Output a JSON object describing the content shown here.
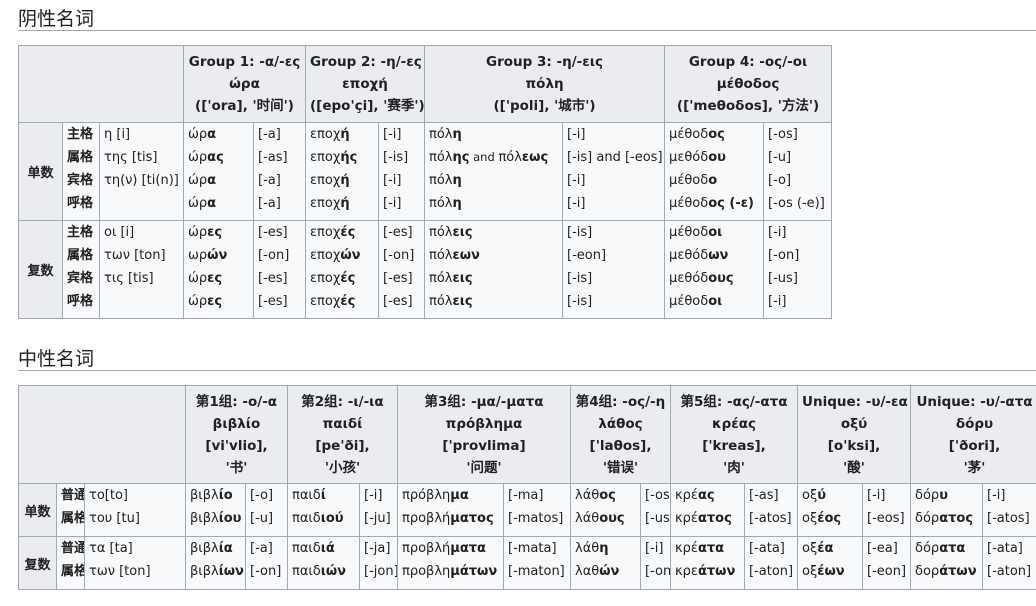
{
  "fem": {
    "title": "阴性名词",
    "groups": [
      {
        "l1": "Group 1: -α/-ες",
        "l2": "ώρα",
        "l3": "(['ora], '时间')"
      },
      {
        "l1": "Group 2: -η/-ες",
        "l2": "εποχή",
        "l3": "([epo'çi], '赛季')"
      },
      {
        "l1": "Group 3: -η/-εις",
        "l2": "πόλη",
        "l3": "(['poli], '城市')"
      },
      {
        "l1": "Group 4: -ος/-οι",
        "l2": "μέθοδος",
        "l3": "(['meθoδos], '方法')"
      }
    ],
    "blocks": [
      {
        "number": "单数",
        "cases": [
          "主格",
          "属格",
          "宾格",
          "呼格"
        ],
        "articles": [
          "η [i]",
          "της [tis]",
          "τη(ν) [ti(n)]",
          ""
        ],
        "cols": [
          {
            "forms": [
              [
                "ώρ",
                "α"
              ],
              [
                "ώρ",
                "ας"
              ],
              [
                "ώρ",
                "α"
              ],
              [
                "ώρ",
                "α"
              ]
            ],
            "ipa": [
              "[-a]",
              "[-as]",
              "[-a]",
              "[-a]"
            ]
          },
          {
            "forms": [
              [
                "εποχ",
                "ή"
              ],
              [
                "εποχ",
                "ής"
              ],
              [
                "εποχ",
                "ή"
              ],
              [
                "εποχ",
                "ή"
              ]
            ],
            "ipa": [
              "[-i]",
              "[-is]",
              "[-i]",
              "[-i]"
            ]
          },
          {
            "forms": [
              [
                "πόλ",
                "η"
              ],
              [
                "πόλ",
                "ης"
              ],
              [
                "πόλ",
                "η"
              ],
              [
                "πόλ",
                "η"
              ]
            ],
            "extra": {
              "and": " and ",
              "stem": "πόλ",
              "end": "εως"
            },
            "ipa": [
              "[-i]",
              "[-is] and [-eos]",
              "[-i]",
              "[-i]"
            ]
          },
          {
            "forms": [
              [
                "μέθοδ",
                "ος"
              ],
              [
                "μεθόδ",
                "ου"
              ],
              [
                "μέθοδ",
                "ο"
              ],
              [
                "μέθοδ",
                "ος (-ε)"
              ]
            ],
            "ipa": [
              "[-os]",
              "[-u]",
              "[-o]",
              "[-os (-e)]"
            ]
          }
        ]
      },
      {
        "number": "复数",
        "cases": [
          "主格",
          "属格",
          "宾格",
          "呼格"
        ],
        "articles": [
          "οι [i]",
          "των [ton]",
          "τις [tis]",
          ""
        ],
        "cols": [
          {
            "forms": [
              [
                "ώρ",
                "ες"
              ],
              [
                "ωρ",
                "ών"
              ],
              [
                "ώρ",
                "ες"
              ],
              [
                "ώρ",
                "ες"
              ]
            ],
            "ipa": [
              "[-es]",
              "[-on]",
              "[-es]",
              "[-es]"
            ]
          },
          {
            "forms": [
              [
                "εποχ",
                "ές"
              ],
              [
                "εποχ",
                "ών"
              ],
              [
                "εποχ",
                "ές"
              ],
              [
                "εποχ",
                "ές"
              ]
            ],
            "ipa": [
              "[-es]",
              "[-on]",
              "[-es]",
              "[-es]"
            ]
          },
          {
            "forms": [
              [
                "πόλ",
                "εις"
              ],
              [
                "πόλ",
                "εων"
              ],
              [
                "πόλ",
                "εις"
              ],
              [
                "πόλ",
                "εις"
              ]
            ],
            "ipa": [
              "[-is]",
              "[-eon]",
              "[-is]",
              "[-is]"
            ]
          },
          {
            "forms": [
              [
                "μέθοδ",
                "οι"
              ],
              [
                "μεθόδ",
                "ων"
              ],
              [
                "μεθόδ",
                "ους"
              ],
              [
                "μέθοδ",
                "οι"
              ]
            ],
            "ipa": [
              "[-i]",
              "[-on]",
              "[-us]",
              "[-i]"
            ]
          }
        ]
      }
    ]
  },
  "neu": {
    "title": "中性名词",
    "groups": [
      {
        "l1": "第1组: -ο/-α",
        "l2": "βιβλίο",
        "l3": "[vi'vlio],",
        "l4": "'书'"
      },
      {
        "l1": "第2组: -ι/-ια",
        "l2": "παιδί",
        "l3": "[pe'ði],",
        "l4": "'小孩'"
      },
      {
        "l1": "第3组: -μα/-ματα",
        "l2": "πρόβλημα",
        "l3": "['provlima]",
        "l4": "'问题'"
      },
      {
        "l1": "第4组: -ος/-η",
        "l2": "λάθος",
        "l3": "['laθos],",
        "l4": "'错误'"
      },
      {
        "l1": "第5组: -ας/-ατα",
        "l2": "κρέας",
        "l3": "['kreas],",
        "l4": "'肉'"
      },
      {
        "l1": "Unique: -υ/-εα",
        "l2": "οξύ",
        "l3": "[o'ksi],",
        "l4": "'酸'"
      },
      {
        "l1": "Unique: -υ/-ατα",
        "l2": "δόρυ",
        "l3": "['ðori],",
        "l4": "'茅'"
      }
    ],
    "blocks": [
      {
        "number": "单数",
        "cases": [
          "普通",
          "属格"
        ],
        "articles": [
          "το[to]",
          "του [tu]"
        ],
        "cols": [
          {
            "forms": [
              [
                "βιβλ",
                "ίο"
              ],
              [
                "βιβλ",
                "ίου"
              ]
            ],
            "ipa": [
              "[-o]",
              "[-u]"
            ]
          },
          {
            "forms": [
              [
                "παιδ",
                "ί"
              ],
              [
                "παιδ",
                "ιού"
              ]
            ],
            "ipa": [
              "[-i]",
              "[-ju]"
            ]
          },
          {
            "forms": [
              [
                "πρόβλη",
                "μα"
              ],
              [
                "προβλή",
                "ματος"
              ]
            ],
            "ipa": [
              "[-ma]",
              "[-matos]"
            ]
          },
          {
            "forms": [
              [
                "λάθ",
                "ος"
              ],
              [
                "λάθ",
                "ους"
              ]
            ],
            "ipa": [
              "[-os]",
              "[-us]"
            ]
          },
          {
            "forms": [
              [
                "κρέ",
                "ας"
              ],
              [
                "κρέ",
                "ατος"
              ]
            ],
            "ipa": [
              "[-as]",
              "[-atos]"
            ]
          },
          {
            "forms": [
              [
                "οξ",
                "ύ"
              ],
              [
                "οξ",
                "έος"
              ]
            ],
            "ipa": [
              "[-i]",
              "[-eos]"
            ]
          },
          {
            "forms": [
              [
                "δόρ",
                "υ"
              ],
              [
                "δόρ",
                "ατος"
              ]
            ],
            "ipa": [
              "[-i]",
              "[-atos]"
            ]
          }
        ]
      },
      {
        "number": "复数",
        "cases": [
          "普通",
          "属格"
        ],
        "articles": [
          "τα [ta]",
          "των [ton]"
        ],
        "cols": [
          {
            "forms": [
              [
                "βιβλ",
                "ία"
              ],
              [
                "βιβλ",
                "ίων"
              ]
            ],
            "ipa": [
              "[-a]",
              "[-on]"
            ]
          },
          {
            "forms": [
              [
                "παιδ",
                "ιά"
              ],
              [
                "παιδ",
                "ιών"
              ]
            ],
            "ipa": [
              "[-ja]",
              "[-jon]"
            ]
          },
          {
            "forms": [
              [
                "προβλή",
                "ματα"
              ],
              [
                "προβλη",
                "μάτων"
              ]
            ],
            "ipa": [
              "[-mata]",
              "[-maton]"
            ]
          },
          {
            "forms": [
              [
                "λάθ",
                "η"
              ],
              [
                "λαθ",
                "ών"
              ]
            ],
            "ipa": [
              "[-i]",
              "[-on]"
            ]
          },
          {
            "forms": [
              [
                "κρέ",
                "ατα"
              ],
              [
                "κρε",
                "άτων"
              ]
            ],
            "ipa": [
              "[-ata]",
              "[-aton]"
            ]
          },
          {
            "forms": [
              [
                "οξ",
                "έα"
              ],
              [
                "οξ",
                "έων"
              ]
            ],
            "ipa": [
              "[-ea]",
              "[-eon]"
            ]
          },
          {
            "forms": [
              [
                "δόρ",
                "ατα"
              ],
              [
                "δορ",
                "άτων"
              ]
            ],
            "ipa": [
              "[-ata]",
              "[-aton]"
            ]
          }
        ]
      }
    ]
  }
}
